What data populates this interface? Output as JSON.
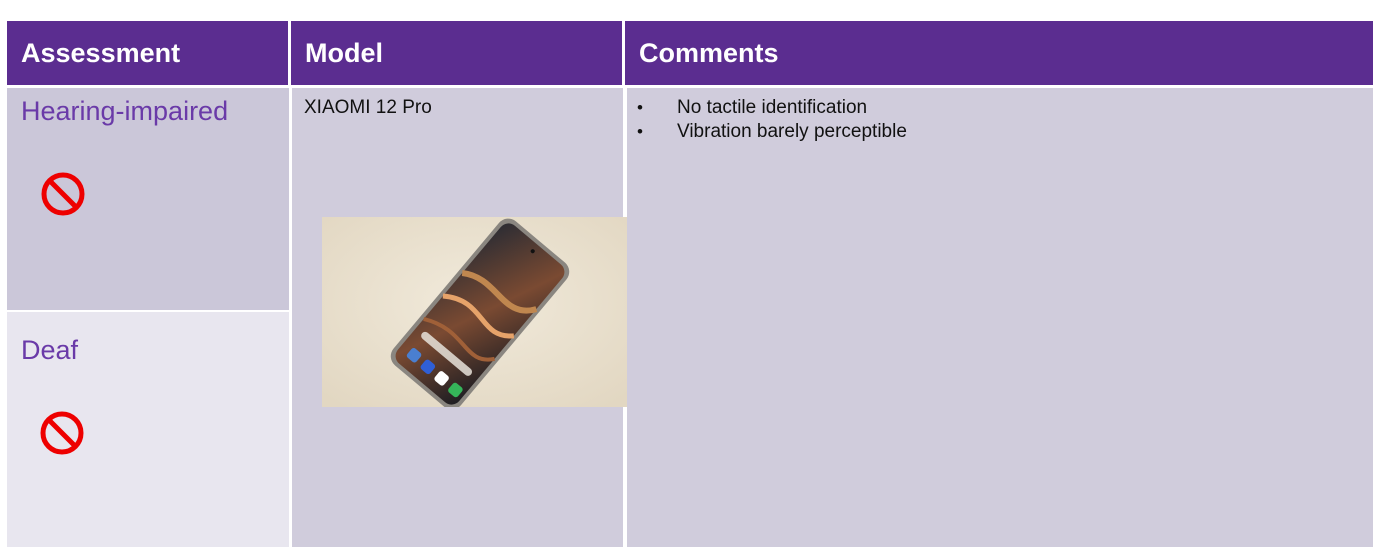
{
  "header": {
    "assessment": "Assessment",
    "model": "Model",
    "comments": "Comments"
  },
  "assessments": [
    {
      "label": "Hearing-impaired",
      "icon": "prohibited-icon"
    },
    {
      "label": "Deaf",
      "icon": "prohibited-icon"
    }
  ],
  "model": {
    "name": "XIAOMI 12 Pro",
    "photo": "phone-photo"
  },
  "comments": {
    "bullet": "•",
    "items": [
      "No tactile identification",
      "Vibration barely perceptible"
    ]
  },
  "colors": {
    "header_bg": "#5b2d90",
    "header_text": "#ffffff",
    "label_purple": "#6a3aa8",
    "prohibited_red": "#ee0000",
    "row_bg_dark": "#cbc7d9",
    "row_bg_light": "#e8e6ef"
  }
}
